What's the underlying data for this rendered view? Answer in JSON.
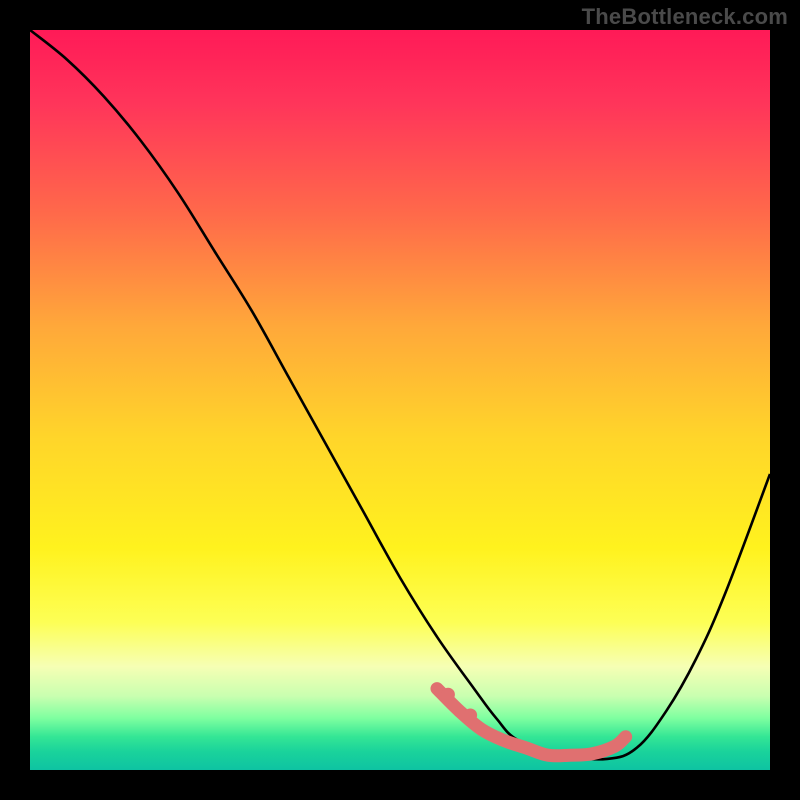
{
  "watermark": "TheBottleneck.com",
  "colors": {
    "page_bg": "#000000",
    "gradient_stops": [
      {
        "offset": 0.0,
        "color": "#ff1a57"
      },
      {
        "offset": 0.1,
        "color": "#ff355a"
      },
      {
        "offset": 0.25,
        "color": "#ff6a4a"
      },
      {
        "offset": 0.4,
        "color": "#ffa83a"
      },
      {
        "offset": 0.55,
        "color": "#ffd52a"
      },
      {
        "offset": 0.7,
        "color": "#fff21e"
      },
      {
        "offset": 0.8,
        "color": "#fdff55"
      },
      {
        "offset": 0.86,
        "color": "#f6ffb4"
      },
      {
        "offset": 0.9,
        "color": "#c9ffb0"
      },
      {
        "offset": 0.93,
        "color": "#7effa0"
      },
      {
        "offset": 0.955,
        "color": "#34e695"
      },
      {
        "offset": 0.975,
        "color": "#1ad39b"
      },
      {
        "offset": 1.0,
        "color": "#0ec3a2"
      }
    ],
    "curve": "#000000",
    "highlight": "#e07070"
  },
  "chart_data": {
    "type": "line",
    "title": "",
    "xlabel": "",
    "ylabel": "",
    "xlim": [
      0,
      100
    ],
    "ylim": [
      0,
      100
    ],
    "series": [
      {
        "name": "bottleneck-curve",
        "x": [
          0,
          5,
          10,
          15,
          20,
          25,
          30,
          35,
          40,
          45,
          50,
          55,
          60,
          63,
          66,
          72,
          78,
          82,
          86,
          90,
          94,
          100
        ],
        "values": [
          100,
          96,
          91,
          85,
          78,
          70,
          62,
          53,
          44,
          35,
          26,
          18,
          11,
          7,
          4,
          2,
          1.5,
          3,
          8,
          15,
          24,
          40
        ]
      }
    ],
    "highlight_segment": {
      "note": "pink/red thick overlay near bottom of V",
      "x": [
        55,
        58,
        61,
        64,
        67,
        70,
        73,
        76,
        79,
        80.5
      ],
      "values": [
        11,
        8,
        5.5,
        4,
        3,
        2,
        2,
        2.2,
        3.2,
        4.5
      ]
    },
    "highlight_dots": {
      "x": [
        56.5,
        59.5
      ],
      "values": [
        10.2,
        7.4
      ]
    }
  }
}
